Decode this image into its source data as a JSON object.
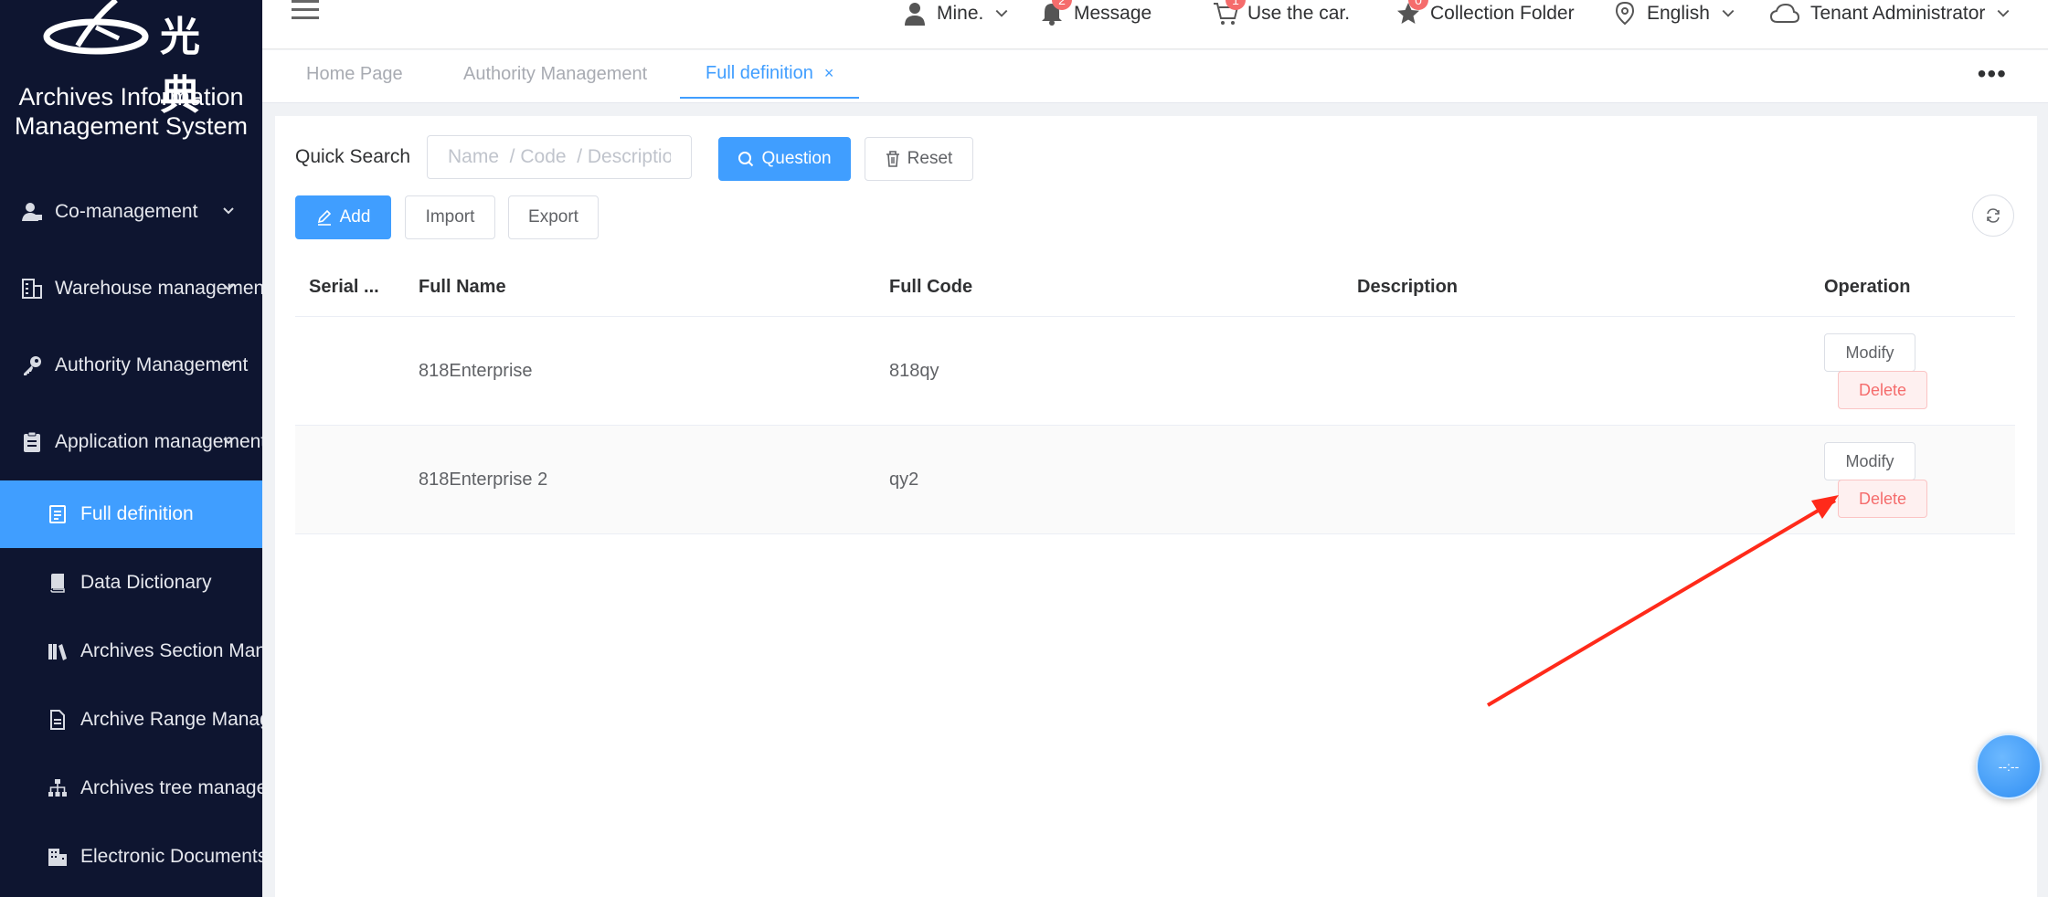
{
  "sidebar": {
    "logo_text": "光典",
    "system_title_line1": "Archives Information",
    "system_title_line2": "Management System",
    "items": [
      {
        "label": "Co-management",
        "icon": "users-icon"
      },
      {
        "label": "Warehouse management",
        "icon": "building-icon"
      },
      {
        "label": "Authority Management",
        "icon": "key-icon"
      },
      {
        "label": "Application management",
        "icon": "clipboard-icon"
      },
      {
        "label": "Full definition",
        "icon": "document-icon",
        "active": true
      },
      {
        "label": "Data Dictionary",
        "icon": "book-icon"
      },
      {
        "label": "Archives Section Management",
        "icon": "books-icon"
      },
      {
        "label": "Archive Range Management",
        "icon": "file-icon"
      },
      {
        "label": "Archives tree management",
        "icon": "tree-icon"
      },
      {
        "label": "Electronic Documents",
        "icon": "office-icon"
      }
    ]
  },
  "header": {
    "mine": "Mine.",
    "message": "Message",
    "message_badge": "2",
    "cart": "Use the car.",
    "cart_badge": "1",
    "collection": "Collection Folder",
    "collection_badge": "0",
    "language": "English",
    "user": "Tenant Administrator"
  },
  "tabs": [
    {
      "label": "Home Page"
    },
    {
      "label": "Authority Management"
    },
    {
      "label": "Full definition",
      "active": true
    }
  ],
  "search": {
    "label": "Quick Search",
    "placeholder": "Name  / Code  / Description",
    "question_label": "Question",
    "reset_label": "Reset"
  },
  "toolbar": {
    "add_label": "Add",
    "import_label": "Import",
    "export_label": "Export"
  },
  "table": {
    "columns": [
      "Serial ...",
      "Full Name",
      "Full Code",
      "Description",
      "Operation"
    ],
    "rows": [
      {
        "name": "818Enterprise",
        "code": "818qy",
        "description": ""
      },
      {
        "name": "818Enterprise 2",
        "code": "qy2",
        "description": ""
      }
    ],
    "modify_label": "Modify",
    "delete_label": "Delete"
  },
  "float_button": {
    "label": "--:--"
  },
  "colors": {
    "primary": "#409eff",
    "sidebar": "#0e1530",
    "danger": "#f56c6c",
    "annotation_arrow": "#ff2a1a"
  }
}
